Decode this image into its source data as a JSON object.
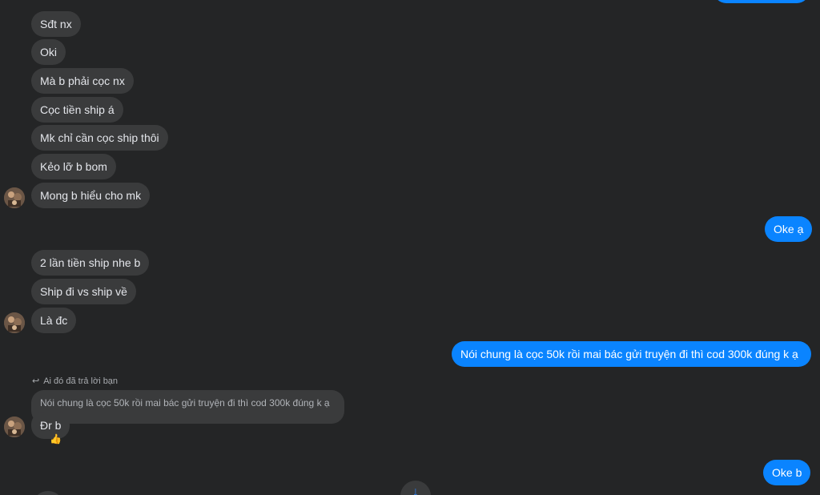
{
  "conversation": {
    "incoming_group_1": [
      "Sđt nx",
      "Oki",
      "Mà b phải cọc nx",
      "Cọc tiền ship á",
      "Mk chỉ cần cọc ship thôi",
      "Kẻo lỡ b bom",
      "Mong b hiểu cho mk"
    ],
    "outgoing_1": "Oke ạ",
    "incoming_group_2": [
      "2 lần tiền ship nhe b",
      "Ship đi vs ship về",
      "Là đc"
    ],
    "outgoing_2": "Nói chung là cọc 50k rồi mai bác gửi truyện đi thì cod 300k đúng k ạ",
    "reply": {
      "header": "Ai đó đã trả lời bạn",
      "quoted": "Nói chung là cọc 50k rồi mai bác gửi truyện đi thì cod 300k đúng k ạ",
      "text": "Đr b",
      "reaction": "👍"
    },
    "outgoing_3": "Oke b"
  },
  "icons": {
    "reply_arrow": "reply-arrow-icon",
    "scroll_down": "arrow-down-icon"
  },
  "colors": {
    "background": "#242526",
    "incoming_bubble": "#3a3b3c",
    "outgoing_bubble": "#0a84ff",
    "text_primary": "#e4e6eb"
  }
}
